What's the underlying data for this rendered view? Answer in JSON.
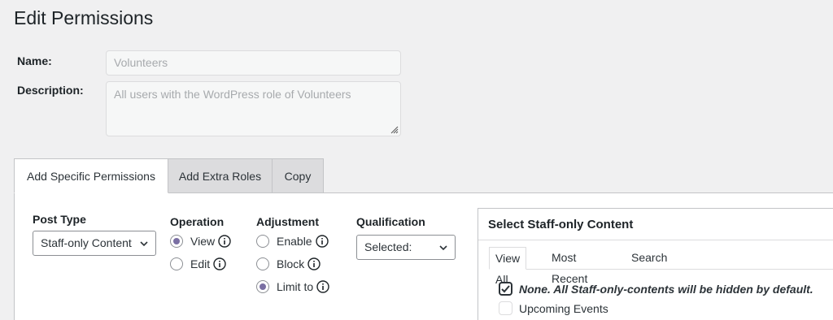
{
  "page": {
    "title": "Edit Permissions"
  },
  "form": {
    "name_label": "Name:",
    "name_value": "Volunteers",
    "description_label": "Description:",
    "description_value": "All users with the WordPress role of Volunteers"
  },
  "tabs": [
    {
      "label": "Add Specific Permissions",
      "active": true
    },
    {
      "label": "Add Extra Roles",
      "active": false
    },
    {
      "label": "Copy",
      "active": false
    }
  ],
  "permissions": {
    "post_type": {
      "label": "Post Type",
      "selected": "Staff-only Content"
    },
    "operation": {
      "label": "Operation",
      "options": [
        {
          "label": "View",
          "checked": true
        },
        {
          "label": "Edit",
          "checked": false
        }
      ]
    },
    "adjustment": {
      "label": "Adjustment",
      "options": [
        {
          "label": "Enable",
          "checked": false
        },
        {
          "label": "Block",
          "checked": false
        },
        {
          "label": "Limit to",
          "checked": true
        }
      ]
    },
    "qualification": {
      "label": "Qualification",
      "selected": "Selected:"
    }
  },
  "content_selector": {
    "title": "Select Staff-only Content",
    "tabs": [
      "View All",
      "Most Recent",
      "Search"
    ],
    "items": [
      {
        "label": "None. All Staff-only-contents will be hidden by default.",
        "checked": true
      },
      {
        "label": "Upcoming Events",
        "checked": false
      }
    ]
  },
  "colors": {
    "accent": "#7a6fa3",
    "border": "#c3c4c7",
    "background": "#f0f0f1"
  }
}
